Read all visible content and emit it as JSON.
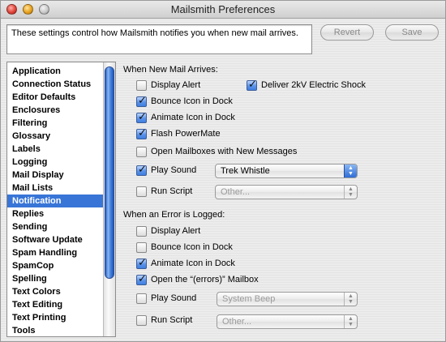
{
  "window": {
    "title": "Mailsmith Preferences"
  },
  "description": "These settings control how Mailsmith notifies you when new mail arrives.",
  "buttons": {
    "revert": "Revert",
    "save": "Save"
  },
  "categories": [
    {
      "label": "Application",
      "selected": false
    },
    {
      "label": "Connection Status",
      "selected": false
    },
    {
      "label": "Editor Defaults",
      "selected": false
    },
    {
      "label": "Enclosures",
      "selected": false
    },
    {
      "label": "Filtering",
      "selected": false
    },
    {
      "label": "Glossary",
      "selected": false
    },
    {
      "label": "Labels",
      "selected": false
    },
    {
      "label": "Logging",
      "selected": false
    },
    {
      "label": "Mail Display",
      "selected": false
    },
    {
      "label": "Mail Lists",
      "selected": false
    },
    {
      "label": "Notification",
      "selected": true
    },
    {
      "label": "Replies",
      "selected": false
    },
    {
      "label": "Sending",
      "selected": false
    },
    {
      "label": "Software Update",
      "selected": false
    },
    {
      "label": "Spam Handling",
      "selected": false
    },
    {
      "label": "SpamCop",
      "selected": false
    },
    {
      "label": "Spelling",
      "selected": false
    },
    {
      "label": "Text Colors",
      "selected": false
    },
    {
      "label": "Text Editing",
      "selected": false
    },
    {
      "label": "Text Printing",
      "selected": false
    },
    {
      "label": "Tools",
      "selected": false
    }
  ],
  "new_mail": {
    "heading": "When New Mail Arrives:",
    "display_alert": {
      "label": "Display Alert",
      "checked": false
    },
    "electric_shock": {
      "label": "Deliver 2kV Electric Shock",
      "checked": true
    },
    "bounce_icon": {
      "label": "Bounce Icon in Dock",
      "checked": true
    },
    "animate_icon": {
      "label": "Animate Icon in Dock",
      "checked": true
    },
    "flash_powermate": {
      "label": "Flash PowerMate",
      "checked": true
    },
    "open_mailboxes": {
      "label": "Open Mailboxes with New Messages",
      "checked": false
    },
    "play_sound": {
      "label": "Play Sound",
      "checked": true,
      "value": "Trek Whistle"
    },
    "run_script": {
      "label": "Run Script",
      "checked": false,
      "value": "Other..."
    }
  },
  "error_logged": {
    "heading": "When an Error is Logged:",
    "display_alert": {
      "label": "Display Alert",
      "checked": false
    },
    "bounce_icon": {
      "label": "Bounce Icon in Dock",
      "checked": false
    },
    "animate_icon": {
      "label": "Animate Icon in Dock",
      "checked": true
    },
    "open_errors": {
      "label": "Open the “(errors)” Mailbox",
      "checked": true
    },
    "play_sound": {
      "label": "Play Sound",
      "checked": false,
      "value": "System Beep"
    },
    "run_script": {
      "label": "Run Script",
      "checked": false,
      "value": "Other..."
    }
  }
}
